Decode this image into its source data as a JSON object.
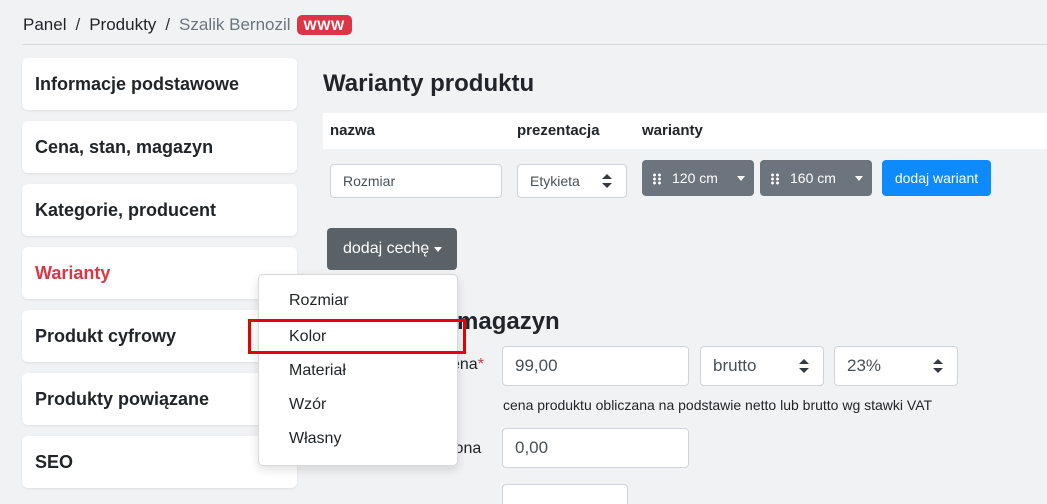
{
  "breadcrumb": {
    "items": [
      "Panel",
      "Produkty",
      "Szalik Bernozil"
    ],
    "separator": "/",
    "badge": "WWW",
    "badge_color": "#dc3545"
  },
  "sidebar": {
    "items": [
      {
        "label": "Informacje podstawowe"
      },
      {
        "label": "Cena, stan, magazyn"
      },
      {
        "label": "Kategorie, producent"
      },
      {
        "label": "Warianty",
        "active": true
      },
      {
        "label": "Produkt cyfrowy"
      },
      {
        "label": "Produkty powiązane"
      },
      {
        "label": "SEO"
      }
    ],
    "active_color": "#dc3545"
  },
  "variants": {
    "title": "Warianty produktu",
    "columns": [
      "nazwa",
      "prezentacja",
      "warianty"
    ],
    "row": {
      "name_value": "Rozmiar",
      "presentation": "Etykieta",
      "variant_values": [
        "120 cm",
        "160 cm"
      ],
      "add_variant_label": "dodaj wariant"
    },
    "add_feature_label": "dodaj cechę",
    "add_feature_menu": [
      "Rozmiar",
      "Kolor",
      "Materiał",
      "Wzór",
      "Własny"
    ],
    "highlighted_option": "Kolor"
  },
  "price_section": {
    "title_visible_fragment": "magazyn",
    "price_label_fragment": "ena",
    "price_value": "99,00",
    "gross_net": "brutto",
    "vat": "23%",
    "help": "cena produktu obliczana na podstawie netto lub brutto wg stawki VAT",
    "second_label_fragment": "lona",
    "second_value": "0,00"
  },
  "colors": {
    "primary": "#0d8bfd",
    "secondary": "#6c757d",
    "dark_button": "#5a6268",
    "annotation": "#e60000"
  }
}
